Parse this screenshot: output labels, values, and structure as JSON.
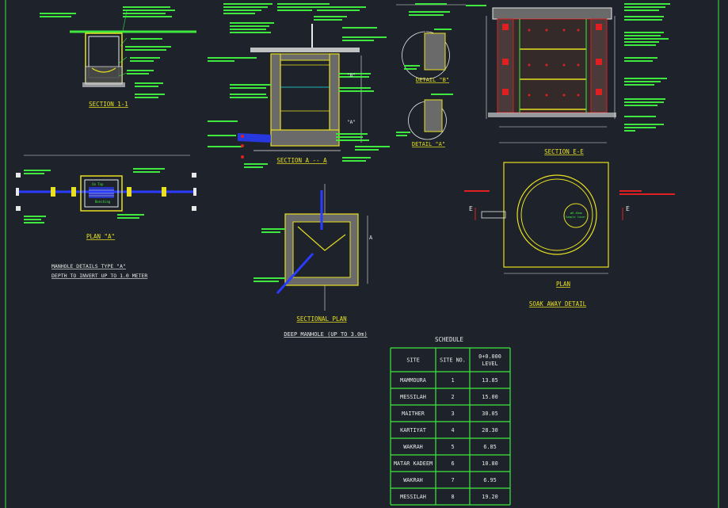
{
  "colors": {
    "background": "#1e232b",
    "line_white": "#e8e8e8",
    "line_yellow": "#e8e020",
    "line_green": "#3ee83e",
    "line_red": "#e02020",
    "line_blue": "#2a3cff",
    "line_cyan": "#20e8e8"
  },
  "section_1_1": {
    "title": "SECTION 1-1"
  },
  "plan_a": {
    "title": "PLAN \"A\"",
    "box_top": "Cm Top",
    "box_bottom": "Benching"
  },
  "manhole_type": {
    "line1": "MANHOLE DETAILS TYPE \"A\"",
    "line2": "DEPTH TO INVERT UP TO 1.0 METER"
  },
  "section_a_a": {
    "title": "SECTION A -- A",
    "tag_b": "\"B\"",
    "tag_a": "\"A\""
  },
  "detail_b": {
    "title": "DETAIL \"B\""
  },
  "detail_a": {
    "title": "DETAIL \"A\""
  },
  "section_e_e": {
    "title": "SECTION E-E"
  },
  "plan": {
    "title": "PLAN",
    "inner_label1": "ø0.45mm",
    "inner_label2": "Sample Cover",
    "marker_left": "E",
    "marker_right": "E"
  },
  "soak_away": {
    "title": "SOAK AWAY DETAIL"
  },
  "sectional_plan": {
    "title": "SECTIONAL PLAN",
    "marker": "A"
  },
  "deep_manhole": {
    "title": "DEEP MANHOLE (UP TO 3.0m)"
  },
  "schedule": {
    "title": "SCHEDULE",
    "headers": [
      "SITE",
      "SITE NO.",
      "0+0.000\nLEVEL"
    ],
    "rows": [
      [
        "MAMMOURA",
        "1",
        "13.85"
      ],
      [
        "MESSILAH",
        "2",
        "15.00"
      ],
      [
        "MAITHER",
        "3",
        "30.05"
      ],
      [
        "KARTIYAT",
        "4",
        "28.30"
      ],
      [
        "WAKRAH",
        "5",
        "6.85"
      ],
      [
        "MATAR KADEEM",
        "6",
        "10.80"
      ],
      [
        "WAKRAH",
        "7",
        "6.95"
      ],
      [
        "MESSILAH",
        "8",
        "19.20"
      ]
    ]
  }
}
